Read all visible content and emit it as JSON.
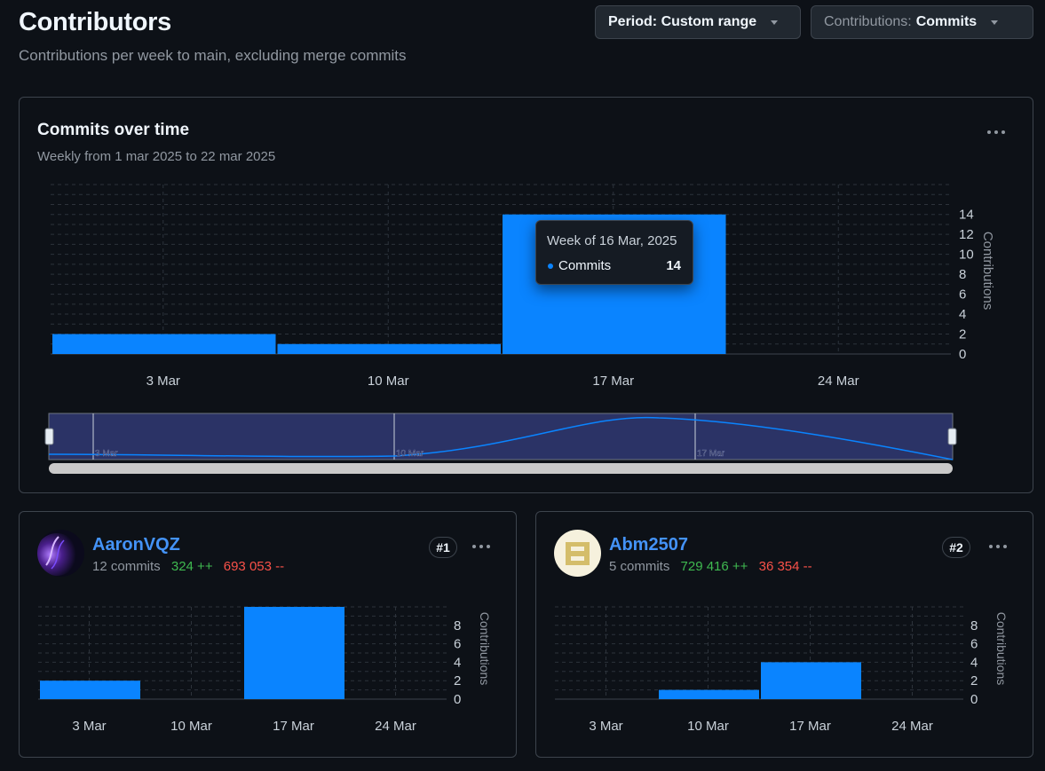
{
  "header": {
    "title": "Contributors",
    "subtitle": "Contributions per week to main, excluding merge commits",
    "period_dropdown": "Period: Custom range",
    "contributions_prefix": "Contributions:",
    "contributions_value": "Commits"
  },
  "main_chart": {
    "title": "Commits over time",
    "subtitle": "Weekly from 1 mar 2025 to 22 mar 2025",
    "tooltip": {
      "title": "Week of 16 Mar, 2025",
      "series": "Commits",
      "value": "14"
    },
    "brush_labels": [
      "3 Mar",
      "10 Mar",
      "17 Mar"
    ]
  },
  "contributors": [
    {
      "name": "AaronVQZ",
      "commits": "12 commits",
      "additions": "324 ++",
      "deletions": "693 053 --",
      "rank": "#1"
    },
    {
      "name": "Abm2507",
      "commits": "5 commits",
      "additions": "729 416 ++",
      "deletions": "36 354 --",
      "rank": "#2"
    }
  ],
  "colors": {
    "bar": "#0a84ff",
    "additions": "#3fb950",
    "deletions": "#f85149",
    "link": "#4493f8"
  },
  "chart_data": [
    {
      "type": "bar",
      "categories": [
        "3 Mar",
        "10 Mar",
        "17 Mar",
        "24 Mar"
      ],
      "values": [
        2,
        1,
        14,
        0
      ],
      "ylabel": "Contributions",
      "yticks": [
        0,
        2,
        4,
        6,
        8,
        10,
        12,
        14
      ],
      "ylim": [
        0,
        17
      ]
    },
    {
      "type": "bar",
      "categories": [
        "3 Mar",
        "10 Mar",
        "17 Mar",
        "24 Mar"
      ],
      "values": [
        2,
        0,
        10,
        0
      ],
      "ylabel": "Contributions",
      "yticks": [
        0,
        2,
        4,
        6,
        8
      ],
      "ylim": [
        0,
        10
      ]
    },
    {
      "type": "bar",
      "categories": [
        "3 Mar",
        "10 Mar",
        "17 Mar",
        "24 Mar"
      ],
      "values": [
        0,
        1,
        4,
        0
      ],
      "ylabel": "Contributions",
      "yticks": [
        0,
        2,
        4,
        6,
        8
      ],
      "ylim": [
        0,
        10
      ]
    }
  ]
}
